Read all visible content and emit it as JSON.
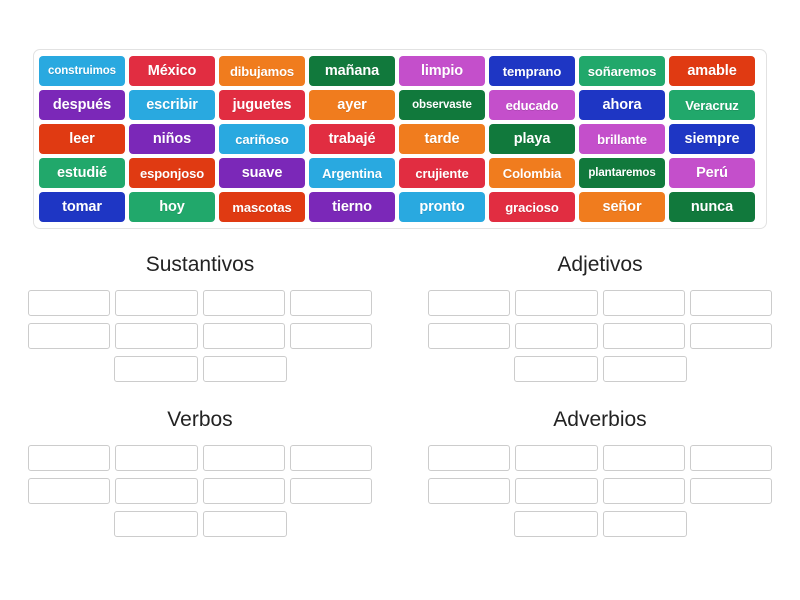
{
  "activity": {
    "type": "group-sort",
    "tile_bank": {
      "rows": [
        [
          {
            "text": "construimos",
            "color": "#29a9e0",
            "size": "long"
          },
          {
            "text": "México",
            "color": "#e12d41",
            "size": "normal"
          },
          {
            "text": "dibujamos",
            "color": "#f07c1e",
            "size": "mid"
          },
          {
            "text": "mañana",
            "color": "#11793c",
            "size": "normal"
          },
          {
            "text": "limpio",
            "color": "#c44fcb",
            "size": "normal"
          },
          {
            "text": "temprano",
            "color": "#1e36c4",
            "size": "mid"
          },
          {
            "text": "soñaremos",
            "color": "#21a86b",
            "size": "mid"
          },
          {
            "text": "amable",
            "color": "#e03a12",
            "size": "normal"
          }
        ],
        [
          {
            "text": "después",
            "color": "#7b28b8",
            "size": "normal"
          },
          {
            "text": "escribir",
            "color": "#29a9e0",
            "size": "normal"
          },
          {
            "text": "juguetes",
            "color": "#e12d41",
            "size": "normal"
          },
          {
            "text": "ayer",
            "color": "#f07c1e",
            "size": "normal"
          },
          {
            "text": "observaste",
            "color": "#11793c",
            "size": "long"
          },
          {
            "text": "educado",
            "color": "#c44fcb",
            "size": "mid"
          },
          {
            "text": "ahora",
            "color": "#1e36c4",
            "size": "normal"
          },
          {
            "text": "Veracruz",
            "color": "#21a86b",
            "size": "mid"
          }
        ],
        [
          {
            "text": "leer",
            "color": "#e03a12",
            "size": "normal"
          },
          {
            "text": "niños",
            "color": "#7b28b8",
            "size": "normal"
          },
          {
            "text": "cariñoso",
            "color": "#29a9e0",
            "size": "mid"
          },
          {
            "text": "trabajé",
            "color": "#e12d41",
            "size": "normal"
          },
          {
            "text": "tarde",
            "color": "#f07c1e",
            "size": "normal"
          },
          {
            "text": "playa",
            "color": "#11793c",
            "size": "normal"
          },
          {
            "text": "brillante",
            "color": "#c44fcb",
            "size": "mid"
          },
          {
            "text": "siempre",
            "color": "#1e36c4",
            "size": "normal"
          }
        ],
        [
          {
            "text": "estudié",
            "color": "#21a86b",
            "size": "normal"
          },
          {
            "text": "esponjoso",
            "color": "#e03a12",
            "size": "mid"
          },
          {
            "text": "suave",
            "color": "#7b28b8",
            "size": "normal"
          },
          {
            "text": "Argentina",
            "color": "#29a9e0",
            "size": "mid"
          },
          {
            "text": "crujiente",
            "color": "#e12d41",
            "size": "mid"
          },
          {
            "text": "Colombia",
            "color": "#f07c1e",
            "size": "mid"
          },
          {
            "text": "plantaremos",
            "color": "#11793c",
            "size": "long"
          },
          {
            "text": "Perú",
            "color": "#c44fcb",
            "size": "normal"
          }
        ],
        [
          {
            "text": "tomar",
            "color": "#1e36c4",
            "size": "normal"
          },
          {
            "text": "hoy",
            "color": "#21a86b",
            "size": "normal"
          },
          {
            "text": "mascotas",
            "color": "#e03a12",
            "size": "mid"
          },
          {
            "text": "tierno",
            "color": "#7b28b8",
            "size": "normal"
          },
          {
            "text": "pronto",
            "color": "#29a9e0",
            "size": "normal"
          },
          {
            "text": "gracioso",
            "color": "#e12d41",
            "size": "mid"
          },
          {
            "text": "señor",
            "color": "#f07c1e",
            "size": "normal"
          },
          {
            "text": "nunca",
            "color": "#11793c",
            "size": "normal"
          }
        ]
      ]
    },
    "categories": [
      {
        "title": "Sustantivos",
        "slot_rows": [
          4,
          4,
          2
        ],
        "slots": [
          "",
          "",
          "",
          "",
          "",
          "",
          "",
          "",
          "",
          ""
        ]
      },
      {
        "title": "Adjetivos",
        "slot_rows": [
          4,
          4,
          2
        ],
        "slots": [
          "",
          "",
          "",
          "",
          "",
          "",
          "",
          "",
          "",
          ""
        ]
      },
      {
        "title": "Verbos",
        "slot_rows": [
          4,
          4,
          2
        ],
        "slots": [
          "",
          "",
          "",
          "",
          "",
          "",
          "",
          "",
          "",
          ""
        ]
      },
      {
        "title": "Adverbios",
        "slot_rows": [
          4,
          4,
          2
        ],
        "slots": [
          "",
          "",
          "",
          "",
          "",
          "",
          "",
          "",
          "",
          ""
        ]
      }
    ]
  }
}
